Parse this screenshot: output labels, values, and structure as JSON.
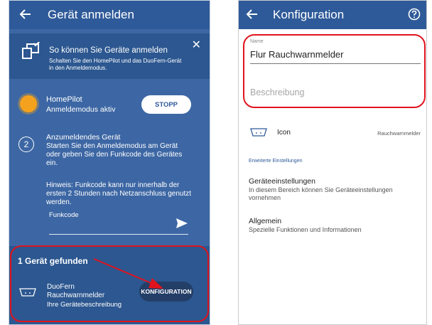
{
  "left": {
    "header_title": "Gerät anmelden",
    "info": {
      "title": "So können Sie Geräte anmelden",
      "subtitle": "Schalten Sie den HomePilot und das DuoFern-Gerät in den Anmeldemodus."
    },
    "homepilot": {
      "name": "HomePilot",
      "status": "Anmeldemodus aktiv",
      "stop_label": "STOPP",
      "dot_color": "#f4a21d"
    },
    "step": {
      "number": "2",
      "title": "Anzumeldendes Gerät",
      "text": "Starten Sie den Anmeldemodus am Gerät oder geben Sie den Funkcode des Gerätes ein.",
      "hint": "Hinweis: Funkcode kann nur innerhalb der ersten 2 Stunden nach Netzanschluss genutzt werden.",
      "code_label": "Funkcode"
    },
    "found": {
      "title": "1 Gerät gefunden",
      "brand": "DuoFern",
      "device": "Rauchwarnmelder",
      "description": "Ihre Gerätebeschreibung",
      "config_label_line1": "KONFIGURATI",
      "config_label_line2": "ON"
    }
  },
  "right": {
    "header_title": "Konfiguration",
    "name_label": "Name",
    "name_value": "Flur Rauchwarnmelder",
    "description_placeholder": "Beschreibung",
    "icon_label": "Icon",
    "icon_value": "Rauchwarnmelder",
    "advanced_label": "Erweiterte Einstellungen",
    "device_settings_title": "Geräteeinstellungen",
    "device_settings_sub": "In diesem Bereich können Sie Geräteeinstellungen vornehmen",
    "general_title": "Allgemein",
    "general_sub": "Spezielle Funktionen und Informationen"
  },
  "colors": {
    "primary": "#3d67a4",
    "header": "#2f5a99",
    "highlight": "#e0141e"
  }
}
